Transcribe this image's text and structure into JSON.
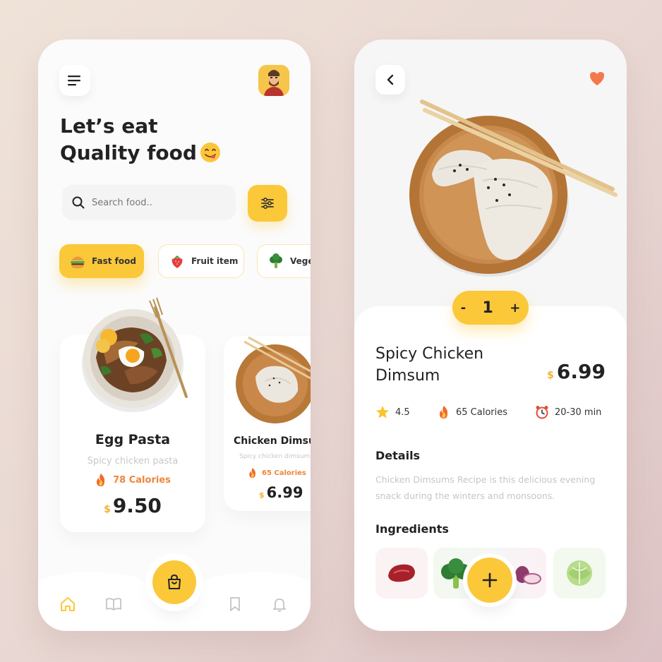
{
  "home": {
    "headline_line1": "Let’s eat",
    "headline_line2": "Quality food",
    "search_placeholder": "Search food..",
    "categories": [
      {
        "label": "Fast food",
        "icon": "burger-icon"
      },
      {
        "label": "Fruit item",
        "icon": "strawberry-icon"
      },
      {
        "label": "Vegetables",
        "icon": "broccoli-icon"
      }
    ],
    "cards": [
      {
        "title": "Egg Pasta",
        "subtitle": "Spicy chicken pasta",
        "calories": "78 Calories",
        "currency": "$",
        "price": "9.50"
      },
      {
        "title": "Chicken Dimsum",
        "subtitle": "Spicy chicken dimsum",
        "calories": "65 Calories",
        "currency": "$",
        "price": "6.99"
      }
    ]
  },
  "detail": {
    "quantity": "1",
    "minus": "-",
    "plus": "+",
    "title_line1": "Spicy Chicken",
    "title_line2": "Dimsum",
    "currency": "$",
    "price": "6.99",
    "rating": "4.5",
    "calories": "65 Calories",
    "time": "20-30 min",
    "details_heading": "Details",
    "details_text": "Chicken Dimsums Recipe is this delicious evening snack during the winters and monsoons.",
    "ingredients_heading": "Ingredients"
  },
  "colors": {
    "accent": "#fbc83a",
    "calorie": "#f0853a",
    "heart": "#f4784e"
  }
}
